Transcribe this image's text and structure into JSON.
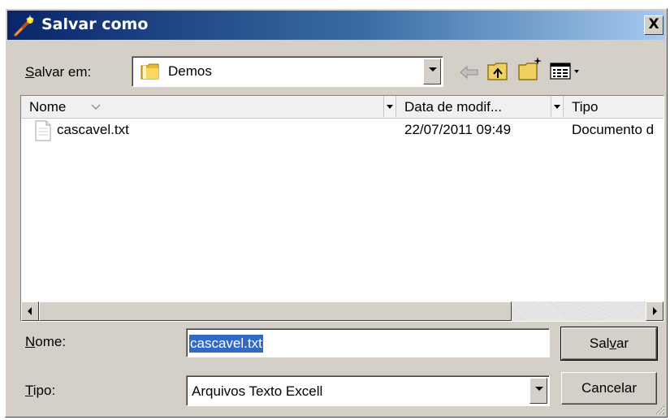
{
  "window": {
    "title": "Salvar como",
    "close_label": "X"
  },
  "save_in": {
    "label": "Salvar em:",
    "hotkey": "S",
    "value": "Demos"
  },
  "toolbar": {
    "icons": [
      "back-arrow-icon",
      "up-folder-icon",
      "new-folder-icon",
      "view-menu-icon"
    ]
  },
  "file_list": {
    "columns": [
      "Nome",
      "Data de modif...",
      "Tipo"
    ],
    "rows": [
      {
        "name": "cascavel.txt",
        "date": "22/07/2011 09:49",
        "type": "Documento d"
      }
    ]
  },
  "filename": {
    "label": "Nome:",
    "hotkey": "N",
    "value": "cascavel.txt"
  },
  "filetype": {
    "label": "Tipo:",
    "hotkey": "T",
    "value": "Arquivos Texto Excell"
  },
  "buttons": {
    "save": "Salvar",
    "save_hotkey": "v",
    "cancel": "Cancelar"
  },
  "colors": {
    "title_start": "#0a246a",
    "title_end": "#a6caf0",
    "dialog_face": "#d4d0c8",
    "selection": "#316ac5"
  }
}
